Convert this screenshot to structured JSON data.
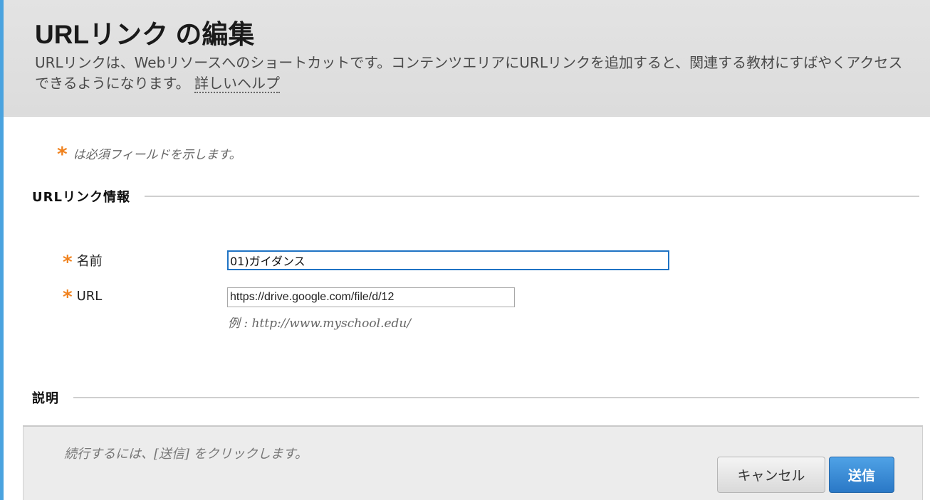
{
  "header": {
    "title": "URLリンク の編集",
    "description": "URLリンクは、Webリソースへのショートカットです。コンテンツエリアにURLリンクを追加すると、関連する教材にすばやくアクセスできるようになります。",
    "help_link": "詳しいヘルプ"
  },
  "required_note": {
    "star": "*",
    "text": "は必須フィールドを示します。"
  },
  "section_url_info": {
    "title": "URLリンク情報"
  },
  "fields": {
    "name": {
      "star": "*",
      "label": "名前",
      "value": "01)ガイダンス"
    },
    "url": {
      "star": "*",
      "label": "URL",
      "value": "https://drive.google.com/file/d/12",
      "example": "例 : http://www.myschool.edu/"
    }
  },
  "section_description": {
    "title": "説明"
  },
  "footer": {
    "instruction": "続行するには、[送信] をクリックします。",
    "cancel_label": "キャンセル",
    "submit_label": "送信"
  },
  "colors": {
    "accent_blue": "#2a78c6",
    "required_star": "#f0821e",
    "left_border": "#4aa3df"
  }
}
